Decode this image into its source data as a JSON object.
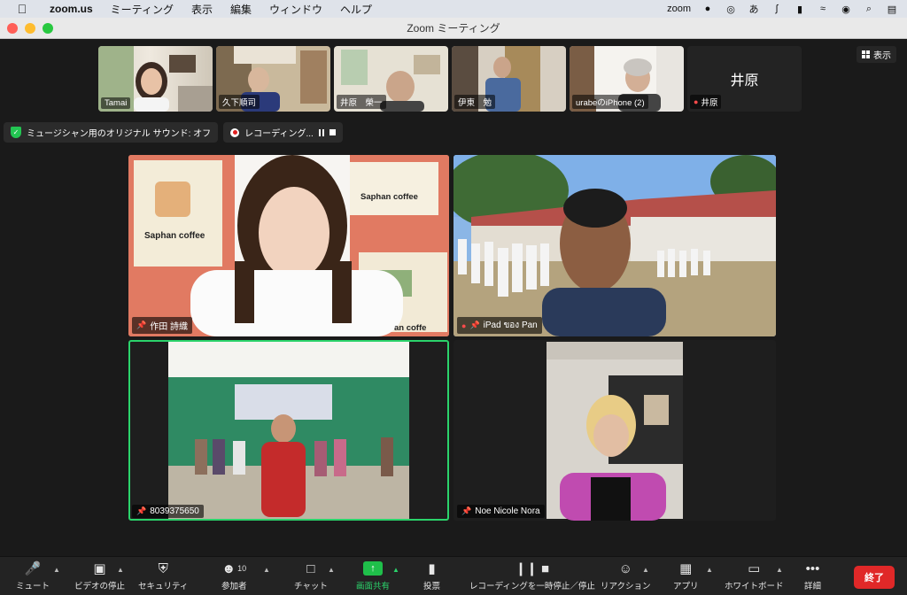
{
  "menubar": {
    "app_name": "zoom.us",
    "items": [
      "ミーティング",
      "表示",
      "編集",
      "ウィンドウ",
      "ヘルプ"
    ],
    "right_app_label": "zoom",
    "input_method": "あ"
  },
  "window": {
    "title": "Zoom ミーティング"
  },
  "view_button": {
    "label": "表示"
  },
  "strip": [
    {
      "name": "Tamai"
    },
    {
      "name": "久下順司"
    },
    {
      "name": "井原　榮一"
    },
    {
      "name": "伊東　勉"
    },
    {
      "name": "urabeのiPhone (2)"
    },
    {
      "name": "井原",
      "avatar_text": "井原",
      "muted": true
    }
  ],
  "status": {
    "audio_label": "ミュージシャン用のオリジナル サウンド: オフ",
    "recording_label": "レコーディング..."
  },
  "tiles": [
    {
      "name": "作田 詩織",
      "sign_text": "Saphan coffee",
      "sign_text2": "Saphan coffee",
      "sign_text3": "an coffe"
    },
    {
      "name": "iPad ของ Pan",
      "muted": true
    },
    {
      "name": "8039375650",
      "banner_text": ""
    },
    {
      "name": "Noe Nicole Nora"
    }
  ],
  "toolbar": {
    "mute": "ミュート",
    "video": "ビデオの停止",
    "security": "セキュリティ",
    "participants": "参加者",
    "participants_count": "10",
    "chat": "チャット",
    "share": "画面共有",
    "poll": "投票",
    "record": "レコーディングを一時停止／停止",
    "reactions": "リアクション",
    "apps": "アプリ",
    "whiteboard": "ホワイトボード",
    "more": "詳細",
    "end": "終了"
  },
  "colors": {
    "accent_green": "#2bd36b",
    "end_red": "#e02828",
    "background": "#1a1a1a"
  }
}
